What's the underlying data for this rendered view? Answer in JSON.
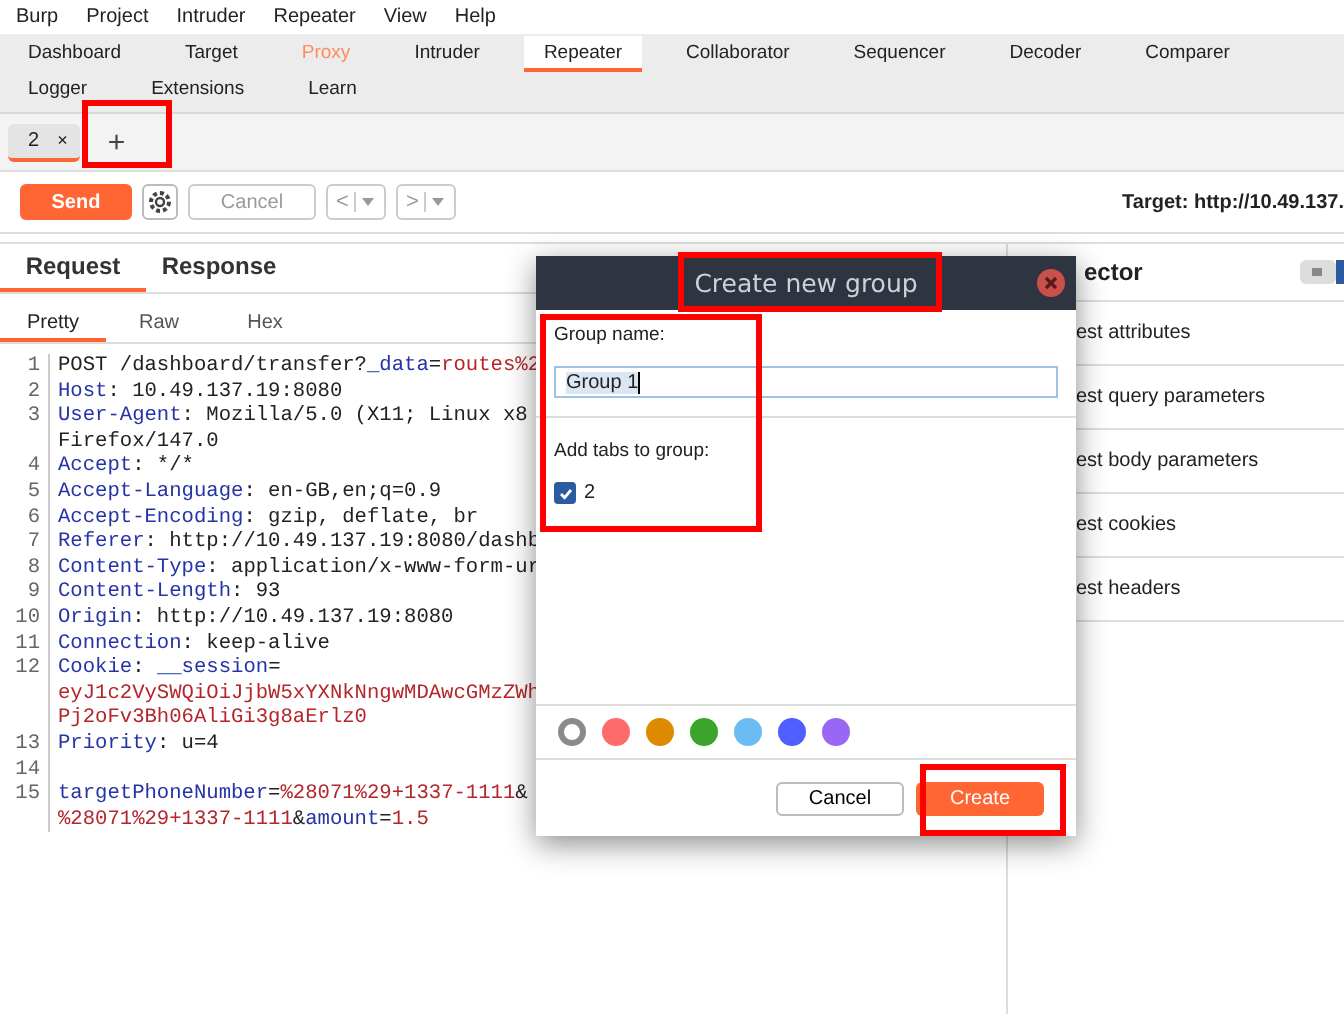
{
  "menu": [
    "Burp",
    "Project",
    "Intruder",
    "Repeater",
    "View",
    "Help"
  ],
  "tools": [
    {
      "label": "Dashboard",
      "selected": false,
      "highlighted": false
    },
    {
      "label": "Target",
      "selected": false,
      "highlighted": false
    },
    {
      "label": "Proxy",
      "selected": false,
      "highlighted": true
    },
    {
      "label": "Intruder",
      "selected": false,
      "highlighted": false
    },
    {
      "label": "Repeater",
      "selected": true,
      "highlighted": false
    },
    {
      "label": "Collaborator",
      "selected": false,
      "highlighted": false
    },
    {
      "label": "Sequencer",
      "selected": false,
      "highlighted": false
    },
    {
      "label": "Decoder",
      "selected": false,
      "highlighted": false
    },
    {
      "label": "Comparer",
      "selected": false,
      "highlighted": false
    },
    {
      "label": "Logger",
      "selected": false,
      "highlighted": false
    },
    {
      "label": "Extensions",
      "selected": false,
      "highlighted": false
    },
    {
      "label": "Learn",
      "selected": false,
      "highlighted": false
    }
  ],
  "repeater_tabs": [
    {
      "label": "2",
      "close": "×",
      "selected": true
    }
  ],
  "new_tab": "+",
  "toolbar": {
    "send": "Send",
    "cancel": "Cancel",
    "back": "<",
    "forward": ">",
    "target": "Target: http://10.49.137."
  },
  "panes": [
    {
      "label": "Request",
      "selected": true
    },
    {
      "label": "Response",
      "selected": false
    }
  ],
  "views": [
    {
      "label": "Pretty",
      "selected": true
    },
    {
      "label": "Raw",
      "selected": false
    },
    {
      "label": "Hex",
      "selected": false
    }
  ],
  "lines": [
    {
      "number": "1",
      "segments": [
        {
          "text": "POST /dashboard/transfer?",
          "kind": "plain"
        },
        {
          "text": "_data",
          "kind": "name"
        },
        {
          "text": "=",
          "kind": "plain"
        },
        {
          "text": "routes%2",
          "kind": "value"
        }
      ]
    },
    {
      "number": "2",
      "segments": [
        {
          "text": "Host",
          "kind": "name"
        },
        {
          "text": ": 10.49.137.19:8080",
          "kind": "plain"
        }
      ]
    },
    {
      "number": "3",
      "segments": [
        {
          "text": "User-Agent",
          "kind": "name"
        },
        {
          "text": ": Mozilla/5.0 (X11; Linux x8",
          "kind": "plain"
        }
      ]
    },
    {
      "segments": [
        {
          "text": "Firefox/147.0",
          "kind": "plain"
        }
      ]
    },
    {
      "number": "4",
      "segments": [
        {
          "text": "Accept",
          "kind": "name"
        },
        {
          "text": ": */*",
          "kind": "plain"
        }
      ]
    },
    {
      "number": "5",
      "segments": [
        {
          "text": "Accept-Language",
          "kind": "name"
        },
        {
          "text": ": en-GB,en;q=0.9",
          "kind": "plain"
        }
      ]
    },
    {
      "number": "6",
      "segments": [
        {
          "text": "Accept-Encoding",
          "kind": "name"
        },
        {
          "text": ": gzip, deflate, br",
          "kind": "plain"
        }
      ]
    },
    {
      "number": "7",
      "segments": [
        {
          "text": "Referer",
          "kind": "name"
        },
        {
          "text": ": http://10.49.137.19:8080/dashb",
          "kind": "plain"
        }
      ]
    },
    {
      "number": "8",
      "segments": [
        {
          "text": "Content-Type",
          "kind": "name"
        },
        {
          "text": ": application/x-www-form-ur",
          "kind": "plain"
        }
      ]
    },
    {
      "number": "9",
      "segments": [
        {
          "text": "Content-Length",
          "kind": "name"
        },
        {
          "text": ": 93",
          "kind": "plain"
        }
      ]
    },
    {
      "number": "10",
      "segments": [
        {
          "text": "Origin",
          "kind": "name"
        },
        {
          "text": ": http://10.49.137.19:8080",
          "kind": "plain"
        }
      ]
    },
    {
      "number": "11",
      "segments": [
        {
          "text": "Connection",
          "kind": "name"
        },
        {
          "text": ": keep-alive",
          "kind": "plain"
        }
      ]
    },
    {
      "number": "12",
      "segments": [
        {
          "text": "Cookie",
          "kind": "name"
        },
        {
          "text": ": ",
          "kind": "plain"
        },
        {
          "text": "__session",
          "kind": "name"
        },
        {
          "text": "=",
          "kind": "plain"
        }
      ]
    },
    {
      "segments": [
        {
          "text": "eyJ1c2VySWQiOiJjbW5xYXNkNngwMDAwcGMzZWh",
          "kind": "value"
        }
      ]
    },
    {
      "segments": [
        {
          "text": "Pj2oFv3Bh06AliGi3g8aErlz0",
          "kind": "value"
        }
      ]
    },
    {
      "number": "13",
      "segments": [
        {
          "text": "Priority",
          "kind": "name"
        },
        {
          "text": ": u=4",
          "kind": "plain"
        }
      ]
    },
    {
      "number": "14"
    },
    {
      "number": "15",
      "segments": [
        {
          "text": "targetPhoneNumber",
          "kind": "name"
        },
        {
          "text": "=",
          "kind": "plain"
        },
        {
          "text": "%28071%29+1337-1111",
          "kind": "value"
        },
        {
          "text": "&",
          "kind": "plain"
        }
      ]
    },
    {
      "segments": [
        {
          "text": "%28071%29+1337-1111",
          "kind": "value"
        },
        {
          "text": "&",
          "kind": "plain"
        },
        {
          "text": "amount",
          "kind": "name"
        },
        {
          "text": "=",
          "kind": "plain"
        },
        {
          "text": "1.5",
          "kind": "value"
        }
      ]
    }
  ],
  "inspector": {
    "title": "ector",
    "sections": [
      "est attributes",
      "est query parameters",
      "est body parameters",
      "est cookies",
      "est headers"
    ]
  },
  "dialog": {
    "title": "Create new group",
    "name_label": "Group name:",
    "name_value": "Group 1",
    "tabs_label": "Add tabs to group:",
    "tabs": [
      {
        "label": "2",
        "checked": true
      }
    ],
    "colors": [
      {
        "color": "#8a8a8a",
        "selected": true
      },
      {
        "color": "#ff6b6b",
        "selected": false
      },
      {
        "color": "#dd8a00",
        "selected": false
      },
      {
        "color": "#3aa52a",
        "selected": false
      },
      {
        "color": "#6bbcf2",
        "selected": false
      },
      {
        "color": "#4f5eff",
        "selected": false
      },
      {
        "color": "#9966f5",
        "selected": false
      }
    ],
    "cancel": "Cancel",
    "create": "Create"
  }
}
